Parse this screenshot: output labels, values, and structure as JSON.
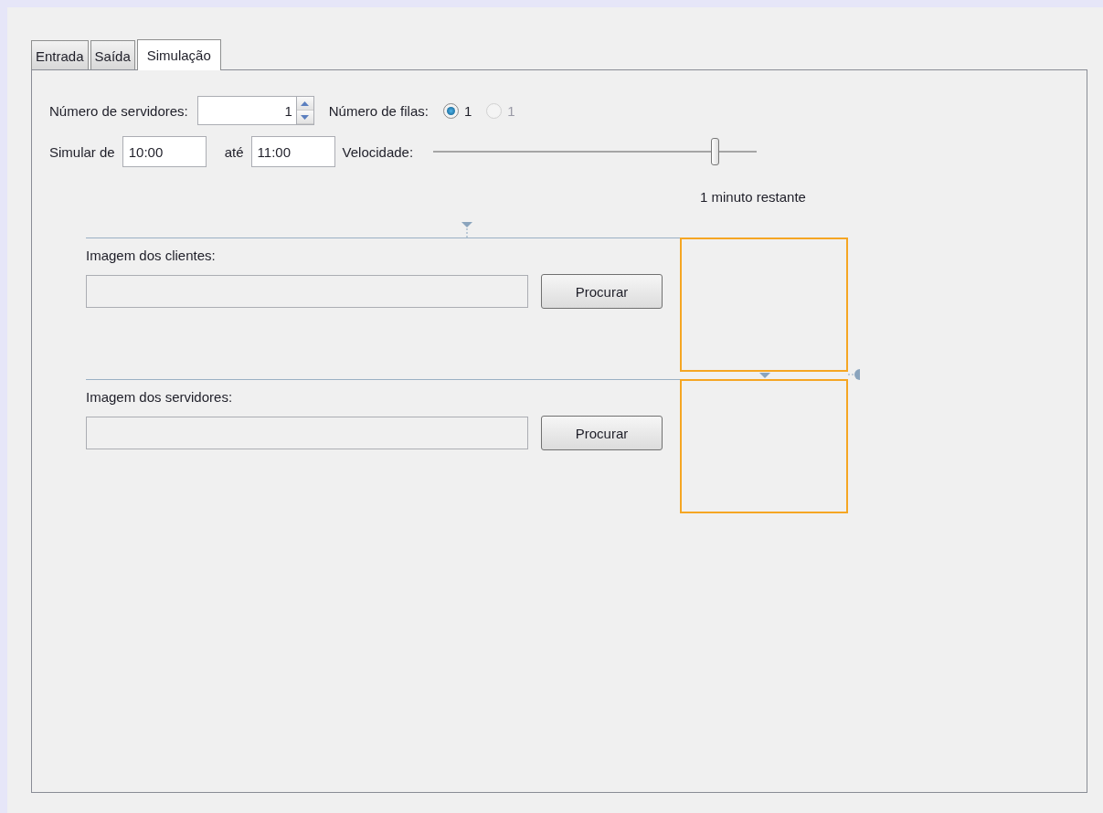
{
  "tabs": [
    {
      "label": "Entrada",
      "selected": false
    },
    {
      "label": "Saída",
      "selected": false
    },
    {
      "label": "Simulação",
      "selected": true
    }
  ],
  "servers": {
    "label": "Número de servidores:",
    "value": "1"
  },
  "queues": {
    "label": "Número de filas:",
    "options": [
      {
        "label": "1",
        "selected": true,
        "disabled": false
      },
      {
        "label": "1",
        "selected": false,
        "disabled": true
      }
    ]
  },
  "simulate": {
    "from_label": "Simular de",
    "from": "10:00",
    "to_label": "até",
    "to": "11:00"
  },
  "speed": {
    "label": "Velocidade:",
    "level": 0.87
  },
  "remaining": "1 minuto restante",
  "image_sections": [
    {
      "label": "Imagem dos clientes:",
      "button": "Procurar"
    },
    {
      "label": "Imagem dos servidores:",
      "button": "Procurar"
    }
  ]
}
